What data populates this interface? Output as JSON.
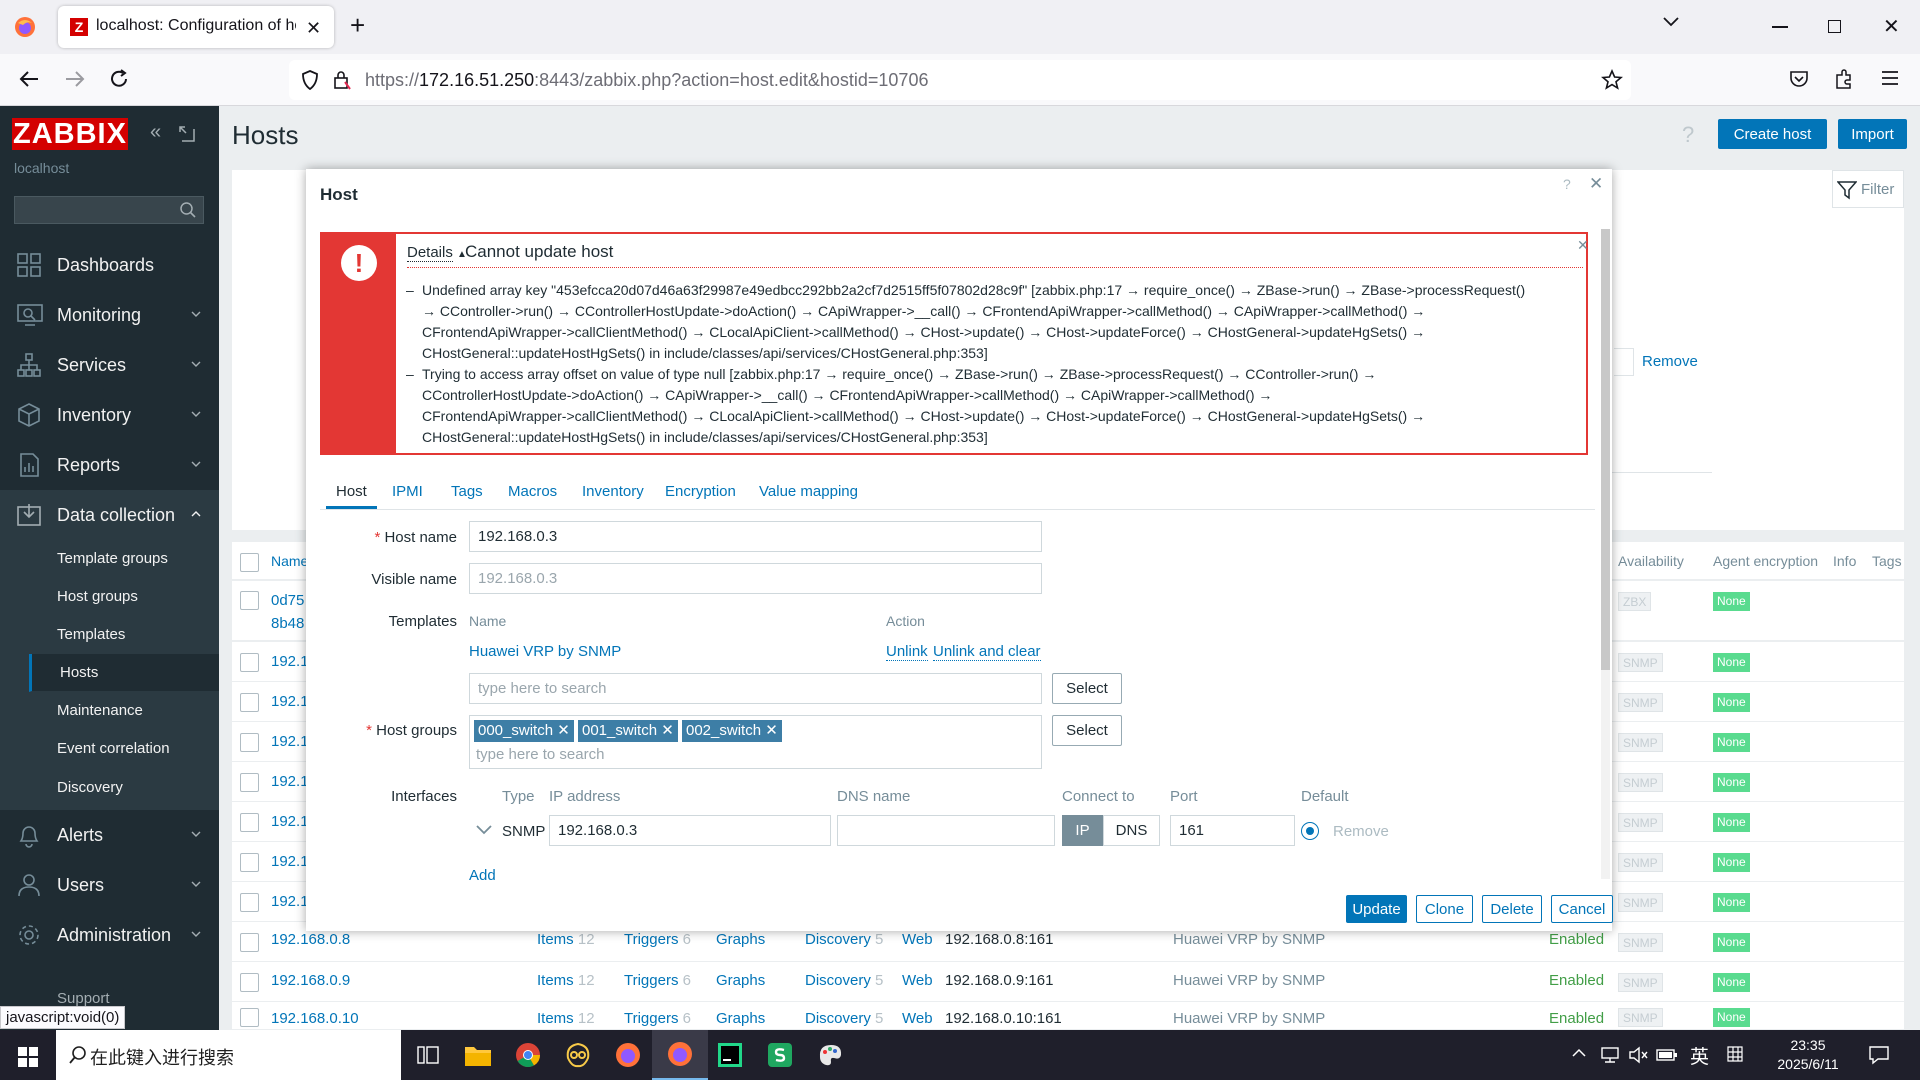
{
  "browser": {
    "tab_title": "localhost: Configuration of ho",
    "url_prefix": "https://",
    "url_host": "172.16.51.250",
    "url_rest": ":8443/zabbix.php?action=host.edit&hostid=10706"
  },
  "sidebar": {
    "logo": "ZABBIX",
    "server_name": "localhost",
    "menu": [
      {
        "label": "Dashboards"
      },
      {
        "label": "Monitoring"
      },
      {
        "label": "Services"
      },
      {
        "label": "Inventory"
      },
      {
        "label": "Reports"
      },
      {
        "label": "Data collection"
      },
      {
        "label": "Alerts"
      },
      {
        "label": "Users"
      },
      {
        "label": "Administration"
      }
    ],
    "submenu": [
      "Template groups",
      "Host groups",
      "Templates",
      "Hosts",
      "Maintenance",
      "Event correlation",
      "Discovery"
    ],
    "support": "Support"
  },
  "page": {
    "title": "Hosts",
    "help": "?",
    "create_host": "Create host",
    "import": "Import",
    "filter": "Filter",
    "remove": "Remove",
    "col_name": "Name",
    "col_availability": "Availability",
    "col_agent_encryption": "Agent encryption",
    "col_info": "Info",
    "col_tags": "Tags"
  },
  "rows": [
    {
      "name": "0d75",
      "name2": "8b48",
      "tag": "ZBX",
      "enc": "None"
    },
    {
      "name": "192.1",
      "tag": "SNMP",
      "enc": "None"
    },
    {
      "name": "192.1",
      "tag": "SNMP",
      "enc": "None"
    },
    {
      "name": "192.1",
      "tag": "SNMP",
      "enc": "None"
    },
    {
      "name": "192.1",
      "tag": "SNMP",
      "enc": "None"
    },
    {
      "name": "192.1",
      "tag": "SNMP",
      "enc": "None"
    },
    {
      "name": "192.1",
      "tag": "SNMP",
      "enc": "None"
    },
    {
      "name": "192.1",
      "tag": "SNMP",
      "enc": "None"
    },
    {
      "name": "192.168.0.8",
      "items": "Items",
      "items_n": "12",
      "triggers": "Triggers",
      "triggers_n": "6",
      "graphs": "Graphs",
      "discovery": "Discovery",
      "discovery_n": "5",
      "web": "Web",
      "iface": "192.168.0.8:161",
      "template": "Huawei VRP by SNMP",
      "status": "Enabled",
      "tag": "SNMP",
      "enc": "None"
    },
    {
      "name": "192.168.0.9",
      "items": "Items",
      "items_n": "12",
      "triggers": "Triggers",
      "triggers_n": "6",
      "graphs": "Graphs",
      "discovery": "Discovery",
      "discovery_n": "5",
      "web": "Web",
      "iface": "192.168.0.9:161",
      "template": "Huawei VRP by SNMP",
      "status": "Enabled",
      "tag": "SNMP",
      "enc": "None"
    },
    {
      "name": "192.168.0.10",
      "items": "Items",
      "items_n": "12",
      "triggers": "Triggers",
      "triggers_n": "6",
      "graphs": "Graphs",
      "discovery": "Discovery",
      "discovery_n": "5",
      "web": "Web",
      "iface": "192.168.0.10:161",
      "template": "Huawei VRP by SNMP",
      "status": "Enabled",
      "tag": "SNMP",
      "enc": "None"
    }
  ],
  "modal": {
    "title": "Host",
    "help": "?",
    "error": {
      "details": "Details",
      "title": "Cannot update host",
      "messages": [
        {
          "lines": [
            "Undefined array key \"453efcca20d07d46a63f29987e49edbcc292bb2a2cf7d2515ff5f07802d28c9f\" [zabbix.php:17 → require_once() → ZBase->run() → ZBase->processRequest()",
            "→ CController->run() → CControllerHostUpdate->doAction() → CApiWrapper->__call() → CFrontendApiWrapper->callMethod() → CApiWrapper->callMethod() →",
            "CFrontendApiWrapper->callClientMethod() → CLocalApiClient->callMethod() → CHost->update() → CHost->updateForce() → CHostGeneral->updateHgSets() →",
            "CHostGeneral::updateHostHgSets() in include/classes/api/services/CHostGeneral.php:353]"
          ]
        },
        {
          "lines": [
            "Trying to access array offset on value of type null [zabbix.php:17 → require_once() → ZBase->run() → ZBase->processRequest() → CController->run() →",
            "CControllerHostUpdate->doAction() → CApiWrapper->__call() → CFrontendApiWrapper->callMethod() → CApiWrapper->callMethod() →",
            "CFrontendApiWrapper->callClientMethod() → CLocalApiClient->callMethod() → CHost->update() → CHost->updateForce() → CHostGeneral->updateHgSets() →",
            "CHostGeneral::updateHostHgSets() in include/classes/api/services/CHostGeneral.php:353]"
          ]
        }
      ]
    },
    "tabs": [
      "Host",
      "IPMI",
      "Tags",
      "Macros",
      "Inventory",
      "Encryption",
      "Value mapping"
    ],
    "host_name_label": "Host name",
    "host_name": "192.168.0.3",
    "visible_name_label": "Visible name",
    "visible_name_placeholder": "192.168.0.3",
    "templates_label": "Templates",
    "templates_col_name": "Name",
    "templates_col_action": "Action",
    "template": "Huawei VRP by SNMP",
    "unlink": "Unlink",
    "unlink_clear": "Unlink and clear",
    "search_placeholder": "type here to search",
    "select": "Select",
    "host_groups_label": "Host groups",
    "groups": [
      "000_switch",
      "001_switch",
      "002_switch"
    ],
    "interfaces_label": "Interfaces",
    "iface_col_type": "Type",
    "iface_col_ip": "IP address",
    "iface_col_dns": "DNS name",
    "iface_col_connect": "Connect to",
    "iface_col_port": "Port",
    "iface_col_default": "Default",
    "iface_type": "SNMP",
    "iface_ip": "192.168.0.3",
    "iface_dns": "",
    "connect_ip": "IP",
    "connect_dns": "DNS",
    "iface_port": "161",
    "remove": "Remove",
    "add": "Add",
    "buttons": {
      "update": "Update",
      "clone": "Clone",
      "delete": "Delete",
      "cancel": "Cancel"
    }
  },
  "statusbar": "javascript:void(0)",
  "taskbar": {
    "search_placeholder": "在此键入进行搜索",
    "ime": "英",
    "time": "23:35",
    "date": "2025/6/11"
  },
  "colors": {
    "sidebar": "#1f2c33",
    "accent": "#0275b8",
    "error": "#e33734",
    "tag_green": "#59db8f"
  }
}
